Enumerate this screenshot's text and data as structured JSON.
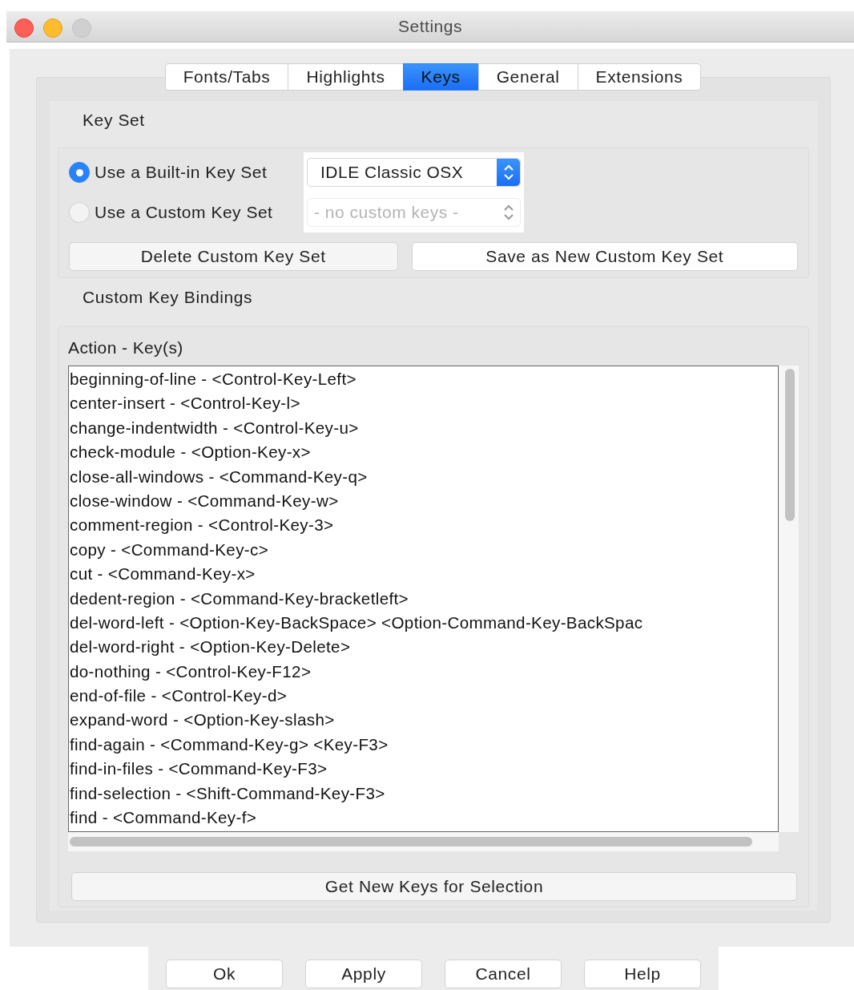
{
  "window": {
    "title": "Settings"
  },
  "tabs": [
    {
      "label": "Fonts/Tabs",
      "selected": false
    },
    {
      "label": "Highlights",
      "selected": false
    },
    {
      "label": "Keys",
      "selected": true
    },
    {
      "label": "General",
      "selected": false
    },
    {
      "label": "Extensions",
      "selected": false
    }
  ],
  "key_set": {
    "title": "Key Set",
    "options": [
      {
        "label": "Use a Built-in Key Set",
        "selected": true,
        "dropdown": {
          "value": "IDLE Classic OSX",
          "disabled": false
        }
      },
      {
        "label": "Use a Custom Key Set",
        "selected": false,
        "dropdown": {
          "value": "- no custom keys -",
          "disabled": true
        }
      }
    ],
    "buttons": [
      {
        "label": "Delete Custom Key Set",
        "kind": "plain"
      },
      {
        "label": "Save as New Custom Key Set",
        "kind": "white"
      }
    ]
  },
  "bindings": {
    "title": "Custom Key Bindings",
    "header": "Action - Key(s)",
    "items": [
      "beginning-of-line - <Control-Key-Left>",
      "center-insert - <Control-Key-l>",
      "change-indentwidth - <Control-Key-u>",
      "check-module - <Option-Key-x>",
      "close-all-windows - <Command-Key-q>",
      "close-window - <Command-Key-w>",
      "comment-region - <Control-Key-3>",
      "copy - <Command-Key-c>",
      "cut - <Command-Key-x>",
      "dedent-region - <Command-Key-bracketleft>",
      "del-word-left - <Option-Key-BackSpace> <Option-Command-Key-BackSpac",
      "del-word-right - <Option-Key-Delete>",
      "do-nothing - <Control-Key-F12>",
      "end-of-file - <Control-Key-d>",
      "expand-word - <Option-Key-slash>",
      "find-again - <Command-Key-g> <Key-F3>",
      "find-in-files - <Command-Key-F3>",
      "find-selection - <Shift-Command-Key-F3>",
      "find - <Command-Key-f>"
    ],
    "button": "Get New Keys for Selection"
  },
  "dialog_buttons": [
    "Ok",
    "Apply",
    "Cancel",
    "Help"
  ]
}
